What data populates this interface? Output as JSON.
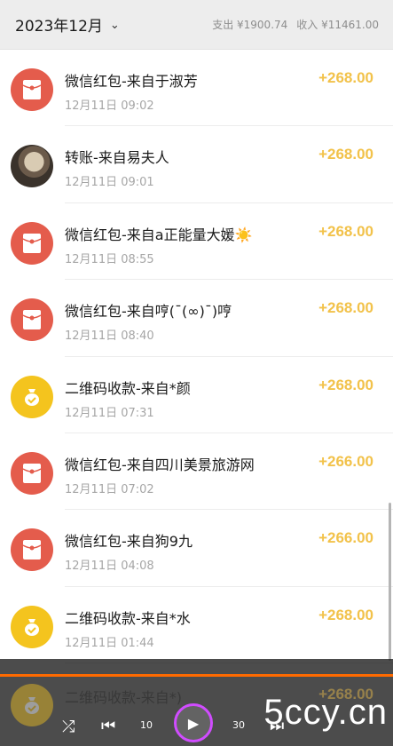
{
  "header": {
    "month": "2023年12月",
    "spend_label": "支出 ¥1900.74",
    "income_label": "收入 ¥11461.00"
  },
  "transactions": [
    {
      "title": "微信红包-来自于淑芳",
      "time": "12月11日 09:02",
      "amount": "+268.00",
      "icon": "red-packet-icon"
    },
    {
      "title": "转账-来自易夫人",
      "time": "12月11日 09:01",
      "amount": "+268.00",
      "icon": "user-avatar-photo"
    },
    {
      "title": "微信红包-来自a正能量大媛☀️",
      "time": "12月11日 08:55",
      "amount": "+268.00",
      "icon": "red-packet-icon"
    },
    {
      "title": "微信红包-来自哼(¯(∞)¯)哼",
      "time": "12月11日 08:40",
      "amount": "+268.00",
      "icon": "red-packet-icon"
    },
    {
      "title": "二维码收款-来自*颜",
      "time": "12月11日 07:31",
      "amount": "+268.00",
      "icon": "money-bag-icon"
    },
    {
      "title": "微信红包-来自四川美景旅游网",
      "time": "12月11日 07:02",
      "amount": "+266.00",
      "icon": "red-packet-icon"
    },
    {
      "title": "微信红包-来自狗9九",
      "time": "12月11日 04:08",
      "amount": "+266.00",
      "icon": "red-packet-icon"
    },
    {
      "title": "二维码收款-来自*水",
      "time": "12月11日 01:44",
      "amount": "+268.00",
      "icon": "money-bag-icon"
    }
  ],
  "partial_row": {
    "title": "二维码收款-来自*)",
    "amount": "+268.00"
  },
  "player": {
    "shuffle": "⤮",
    "prev": "⏮",
    "rewind": "10",
    "play": "▶",
    "forward": "30",
    "next": "⏭"
  },
  "watermark": "5ccy.cn",
  "colors": {
    "amount": "#f2c24a",
    "red_packet": "#e45c4c",
    "money_bag": "#f4c41e"
  }
}
